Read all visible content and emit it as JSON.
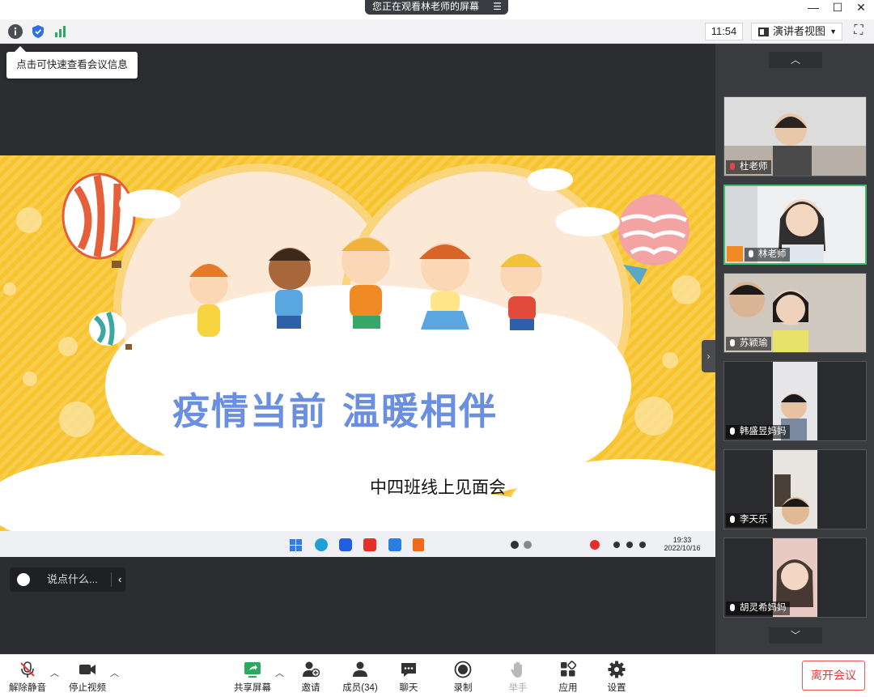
{
  "titlebar": {
    "share_notice": "您正在观看林老师的屏幕",
    "menu_icon": "menu-lines-icon"
  },
  "window_controls": {
    "minimize": "—",
    "maximize": "☐",
    "close": "✕"
  },
  "toolbar": {
    "meeting_time": "11:54",
    "view_mode": "演讲者视图",
    "view_caret": "▼",
    "fullscreen": "⛶",
    "info_tooltip": "点击可快速查看会议信息"
  },
  "slide": {
    "title": "疫情当前 温暖相伴",
    "subtitle": "中四班线上见面会",
    "taskbar_time": "19:33",
    "taskbar_date": "2022/10/16"
  },
  "chat": {
    "placeholder": "说点什么...",
    "chevron": "‹"
  },
  "stage": {
    "side_toggle": "›"
  },
  "gallery": {
    "up_arrow": "︿",
    "down_arrow": "﹀",
    "participants": [
      {
        "name": "杜老师",
        "muted": true
      },
      {
        "name": "林老师",
        "muted": false,
        "active": true,
        "host": true
      },
      {
        "name": "苏颖瑜",
        "muted": false
      },
      {
        "name": "韩盛昱妈妈",
        "muted": false
      },
      {
        "name": "李天乐",
        "muted": false
      },
      {
        "name": "胡灵希妈妈",
        "muted": false
      }
    ]
  },
  "bottom_bar": {
    "unmute": "解除静音",
    "stop_video": "停止视频",
    "share_screen": "共享屏幕",
    "invite": "邀请",
    "members": "成员(34)",
    "chat": "聊天",
    "record": "录制",
    "raise_hand": "举手",
    "apps": "应用",
    "settings": "设置",
    "leave": "离开会议",
    "caret": "︿"
  },
  "colors": {
    "share_green": "#2ea862",
    "leave_red": "#e23a3a",
    "active_border": "#3fbf6a",
    "slide_yellow": "#f7c430"
  }
}
